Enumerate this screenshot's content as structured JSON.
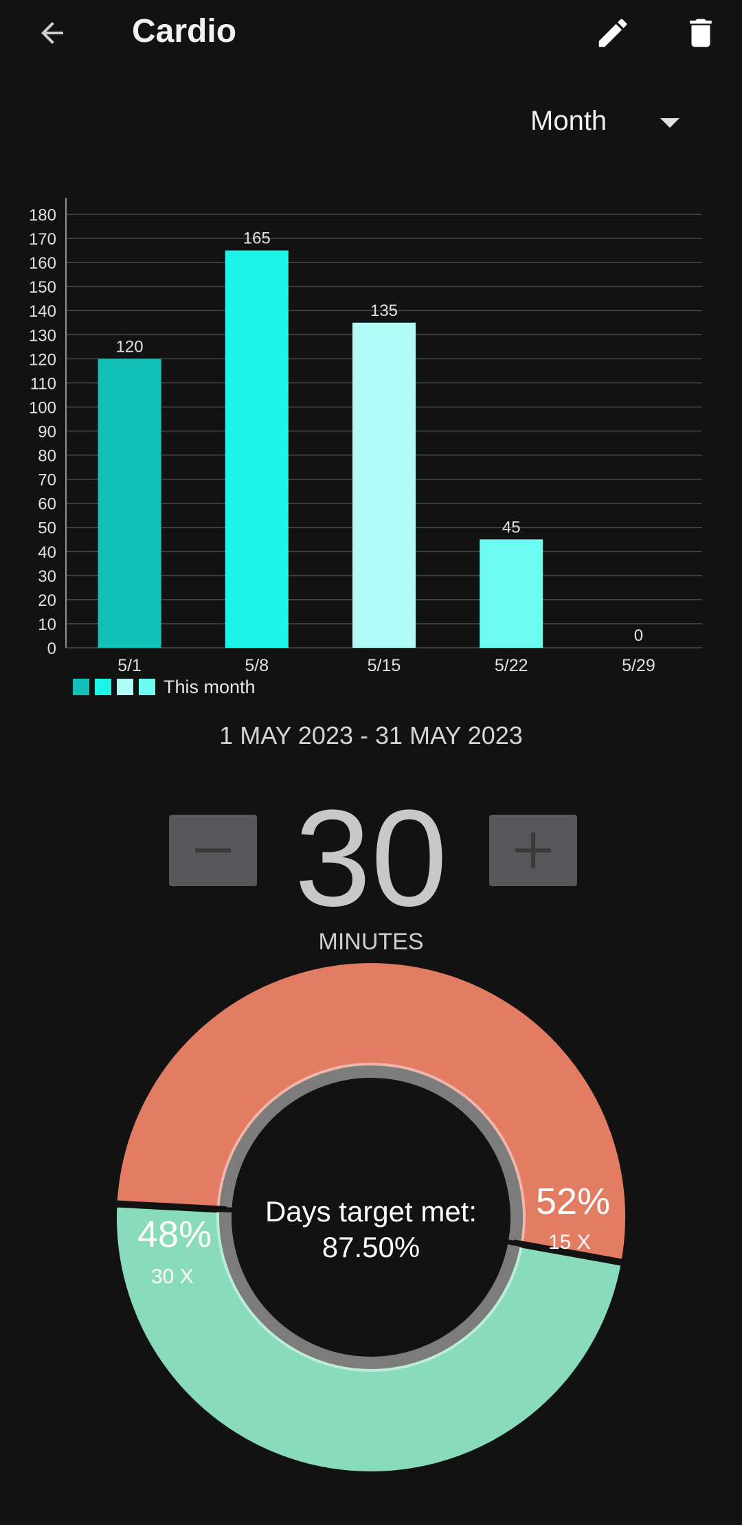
{
  "header": {
    "title": "Cardio",
    "back_icon": "arrow-left-icon",
    "edit_icon": "pencil-icon",
    "delete_icon": "trash-icon"
  },
  "period": {
    "selected": "Month"
  },
  "chart_data": {
    "type": "bar",
    "categories": [
      "5/1",
      "5/8",
      "5/15",
      "5/22",
      "5/29"
    ],
    "values": [
      120,
      165,
      135,
      45,
      0
    ],
    "data_labels": [
      "120",
      "165",
      "135",
      "45",
      "0"
    ],
    "bar_colors": [
      "#12c1b8",
      "#1ef4e8",
      "#b3fbf7",
      "#6dfaf1",
      "#6dfaf1"
    ],
    "ylim": [
      0,
      180
    ],
    "yticks": [
      0,
      10,
      20,
      30,
      40,
      50,
      60,
      70,
      80,
      90,
      100,
      110,
      120,
      130,
      140,
      150,
      160,
      170,
      180
    ],
    "grid": true,
    "legend": {
      "label": "This month",
      "colors": [
        "#12c1b8",
        "#1ef4e8",
        "#b3fbf7",
        "#6dfaf1"
      ],
      "placement": "bottom-left"
    }
  },
  "date_range": "1 MAY 2023 - 31 MAY 2023",
  "target": {
    "value": "30",
    "unit": "MINUTES",
    "decrement_icon": "minus-icon",
    "increment_icon": "plus-icon"
  },
  "donut": {
    "center_line1": "Days target met:",
    "center_line2": "87.50%",
    "slices": [
      {
        "percent": "52%",
        "count": "15 X",
        "value": 52,
        "color": "#e27c63"
      },
      {
        "percent": "48%",
        "count": "30 X",
        "value": 48,
        "color": "#88dcbb"
      }
    ]
  },
  "colors": {
    "background": "#121212",
    "gridline": "#4a4a4a",
    "stepper_button": "#58585a"
  }
}
